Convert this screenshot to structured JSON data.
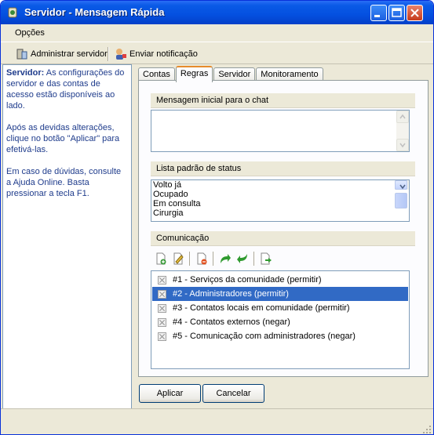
{
  "window": {
    "title": "Servidor - Mensagem Rápida",
    "icon": "app-icon",
    "controls": [
      "minimize-icon",
      "maximize-icon",
      "close-icon"
    ]
  },
  "menu": {
    "items": [
      "Opções"
    ]
  },
  "toolbar": {
    "admin_label": "Administrar servidor",
    "notify_label": "Enviar notificação"
  },
  "help": {
    "heading": "Servidor:",
    "p1": " As configurações do servidor e das contas de acesso estão disponíveis ao lado.",
    "p2": "Após as devidas alterações, clique no botão \"Aplicar\" para efetivá-las.",
    "p3": "Em caso de dúvidas, consulte a Ajuda Online. Basta pressionar a tecla F1."
  },
  "tabs": [
    "Contas",
    "Regras",
    "Servidor",
    "Monitoramento"
  ],
  "active_tab": "Regras",
  "regras": {
    "msg_label": "Mensagem inicial para o chat",
    "msg_value": "",
    "status_label": "Lista padrão de status",
    "status_items": [
      "Volto já",
      "Ocupado",
      "Em consulta",
      "Cirurgia"
    ],
    "com_label": "Comunicação",
    "com_tools": [
      "add-rule-icon",
      "edit-rule-icon",
      "delete-rule-icon",
      "move-up-icon",
      "move-down-icon",
      "export-icon"
    ],
    "rules": [
      "#1 - Serviços da comunidade (permitir)",
      "#2 - Administradores (permitir)",
      "#3 - Contatos locais em comunidade (permitir)",
      "#4 - Contatos externos (negar)",
      "#5 - Comunicação com administradores (negar)"
    ],
    "selected_rule": 2
  },
  "buttons": {
    "apply": "Aplicar",
    "cancel": "Cancelar"
  },
  "colors": {
    "titlebar": "#0450e0",
    "selection": "#316ac5",
    "help_text": "#1f3c8c",
    "tab_highlight": "#e68b2c"
  }
}
